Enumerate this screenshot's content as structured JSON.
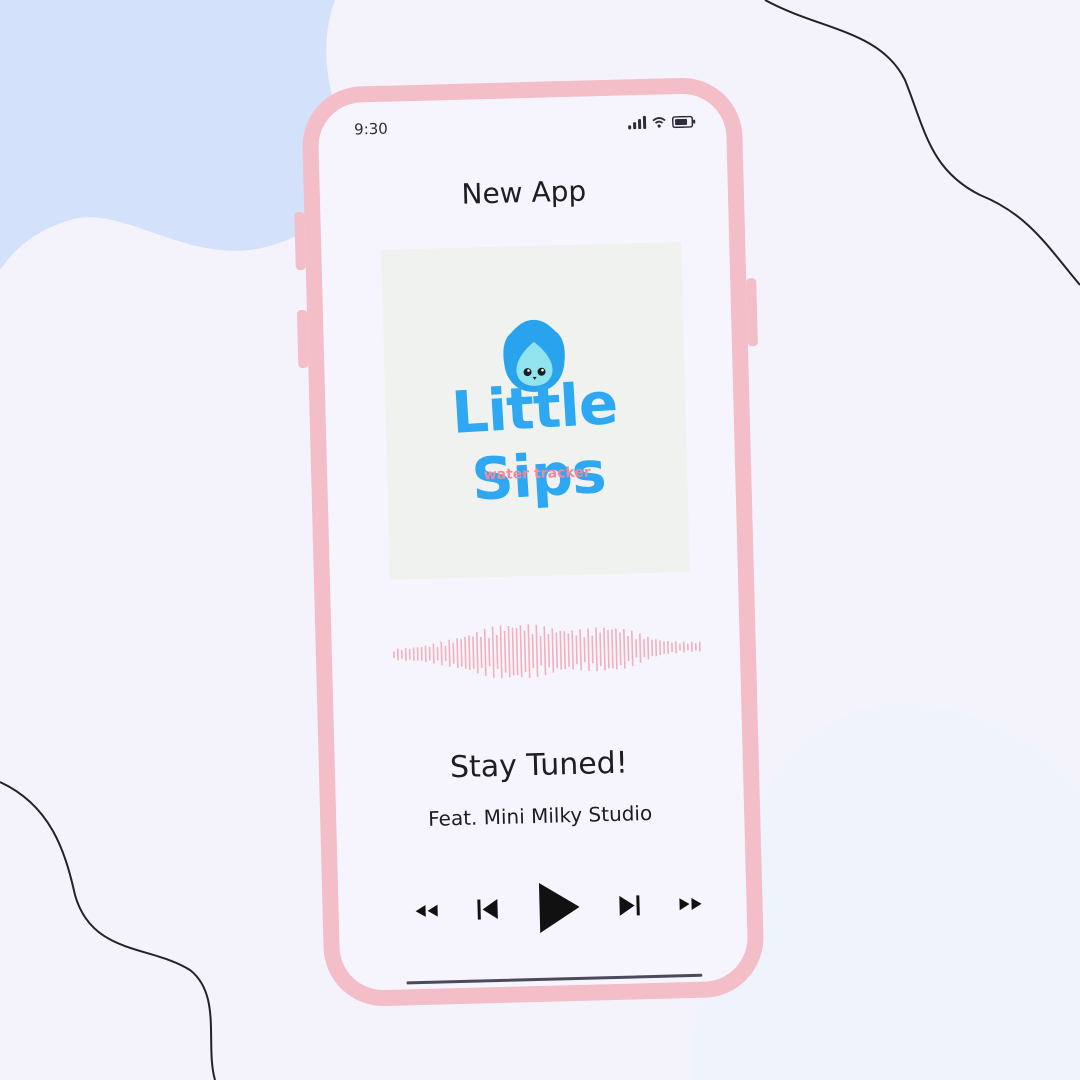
{
  "status_bar": {
    "time": "9:30"
  },
  "header": {
    "title": "New App"
  },
  "cover": {
    "app_name": "Little Sips",
    "tagline": "water tracker"
  },
  "track": {
    "title": "Stay Tuned!",
    "artist": "Feat. Mini Milky Studio"
  },
  "controls": {
    "items": [
      {
        "name": "rewind",
        "icon": "rewind-icon"
      },
      {
        "name": "previous",
        "icon": "skip-previous-icon"
      },
      {
        "name": "play",
        "icon": "play-icon"
      },
      {
        "name": "next",
        "icon": "skip-next-icon"
      },
      {
        "name": "fast-forward",
        "icon": "fast-forward-icon"
      }
    ]
  },
  "colors": {
    "phone_frame": "#f3bec8",
    "brand_blue": "#2ea8f2",
    "tagline_pink": "#f08a9c",
    "waveform_pink": "#f2b0bc",
    "background": "#f4f3fc",
    "blob_blue": "#d3e1fb"
  }
}
